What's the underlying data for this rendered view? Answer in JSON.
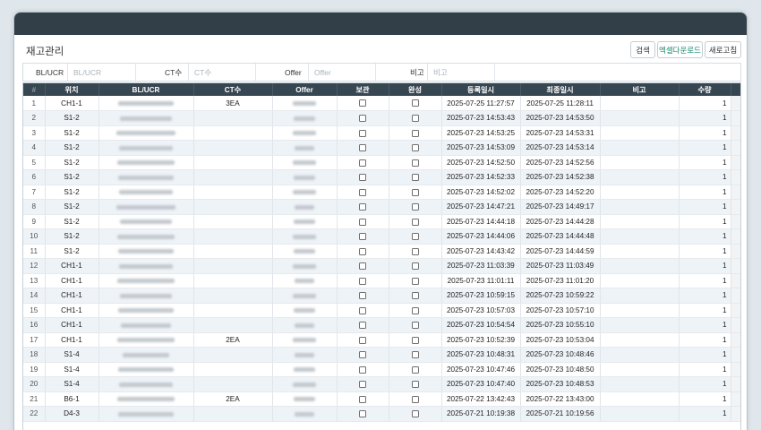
{
  "page": {
    "title": "재고관리"
  },
  "toolbar": {
    "search_label": "검색",
    "excel_label": "엑셀다운로드",
    "refresh_label": "새로고침"
  },
  "filters": {
    "bl_label": "BL/UCR",
    "bl_placeholder": "BL/UCR",
    "ct_label": "CT수",
    "ct_placeholder": "CT수",
    "offer_label": "Offer",
    "offer_placeholder": "Offer",
    "note_label": "비고",
    "note_placeholder": "비고"
  },
  "table": {
    "columns": [
      "#",
      "위치",
      "BL/UCR",
      "CT수",
      "Offer",
      "보관",
      "완성",
      "등록일시",
      "최종일시",
      "비고",
      "수량"
    ],
    "rows": [
      {
        "n": "1",
        "loc": "CH1-1",
        "ct": "3EA",
        "reg": "2025-07-25 11:27:57",
        "last": "2025-07-25 11:28:11",
        "qty": "1"
      },
      {
        "n": "2",
        "loc": "S1-2",
        "ct": "",
        "reg": "2025-07-23 14:53:43",
        "last": "2025-07-23 14:53:50",
        "qty": "1"
      },
      {
        "n": "3",
        "loc": "S1-2",
        "ct": "",
        "reg": "2025-07-23 14:53:25",
        "last": "2025-07-23 14:53:31",
        "qty": "1"
      },
      {
        "n": "4",
        "loc": "S1-2",
        "ct": "",
        "reg": "2025-07-23 14:53:09",
        "last": "2025-07-23 14:53:14",
        "qty": "1"
      },
      {
        "n": "5",
        "loc": "S1-2",
        "ct": "",
        "reg": "2025-07-23 14:52:50",
        "last": "2025-07-23 14:52:56",
        "qty": "1"
      },
      {
        "n": "6",
        "loc": "S1-2",
        "ct": "",
        "reg": "2025-07-23 14:52:33",
        "last": "2025-07-23 14:52:38",
        "qty": "1"
      },
      {
        "n": "7",
        "loc": "S1-2",
        "ct": "",
        "reg": "2025-07-23 14:52:02",
        "last": "2025-07-23 14:52:20",
        "qty": "1"
      },
      {
        "n": "8",
        "loc": "S1-2",
        "ct": "",
        "reg": "2025-07-23 14:47:21",
        "last": "2025-07-23 14:49:17",
        "qty": "1"
      },
      {
        "n": "9",
        "loc": "S1-2",
        "ct": "",
        "reg": "2025-07-23 14:44:18",
        "last": "2025-07-23 14:44:28",
        "qty": "1"
      },
      {
        "n": "10",
        "loc": "S1-2",
        "ct": "",
        "reg": "2025-07-23 14:44:06",
        "last": "2025-07-23 14:44:48",
        "qty": "1"
      },
      {
        "n": "11",
        "loc": "S1-2",
        "ct": "",
        "reg": "2025-07-23 14:43:42",
        "last": "2025-07-23 14:44:59",
        "qty": "1"
      },
      {
        "n": "12",
        "loc": "CH1-1",
        "ct": "",
        "reg": "2025-07-23 11:03:39",
        "last": "2025-07-23 11:03:49",
        "qty": "1"
      },
      {
        "n": "13",
        "loc": "CH1-1",
        "ct": "",
        "reg": "2025-07-23 11:01:11",
        "last": "2025-07-23 11:01:20",
        "qty": "1"
      },
      {
        "n": "14",
        "loc": "CH1-1",
        "ct": "",
        "reg": "2025-07-23 10:59:15",
        "last": "2025-07-23 10:59:22",
        "qty": "1"
      },
      {
        "n": "15",
        "loc": "CH1-1",
        "ct": "",
        "reg": "2025-07-23 10:57:03",
        "last": "2025-07-23 10:57:10",
        "qty": "1"
      },
      {
        "n": "16",
        "loc": "CH1-1",
        "ct": "",
        "reg": "2025-07-23 10:54:54",
        "last": "2025-07-23 10:55:10",
        "qty": "1"
      },
      {
        "n": "17",
        "loc": "CH1-1",
        "ct": "2EA",
        "reg": "2025-07-23 10:52:39",
        "last": "2025-07-23 10:53:04",
        "qty": "1"
      },
      {
        "n": "18",
        "loc": "S1-4",
        "ct": "",
        "reg": "2025-07-23 10:48:31",
        "last": "2025-07-23 10:48:46",
        "qty": "1"
      },
      {
        "n": "19",
        "loc": "S1-4",
        "ct": "",
        "reg": "2025-07-23 10:47:46",
        "last": "2025-07-23 10:48:50",
        "qty": "1"
      },
      {
        "n": "20",
        "loc": "S1-4",
        "ct": "",
        "reg": "2025-07-23 10:47:40",
        "last": "2025-07-23 10:48:53",
        "qty": "1"
      },
      {
        "n": "21",
        "loc": "B6-1",
        "ct": "2EA",
        "reg": "2025-07-22 13:42:43",
        "last": "2025-07-22 13:43:00",
        "qty": "1"
      },
      {
        "n": "22",
        "loc": "D4-3",
        "ct": "",
        "reg": "2025-07-21 10:19:38",
        "last": "2025-07-21 10:19:56",
        "qty": "1"
      }
    ]
  }
}
